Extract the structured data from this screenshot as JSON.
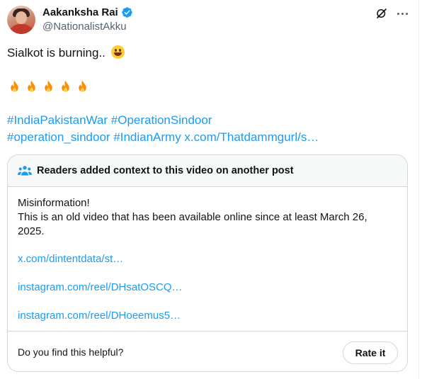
{
  "author": {
    "display_name": "Aakanksha Rai",
    "handle": "@NationalistAkku",
    "verified": true,
    "avatar_icon": "profile-photo"
  },
  "header_actions": {
    "grok_icon": "grok-icon",
    "more_icon": "more-options-icon"
  },
  "tweet": {
    "text": "Sialkot is burning..",
    "text_emoji": "grinning-sweat-emoji",
    "fire_emojis": [
      "fire",
      "fire",
      "fire",
      "fire",
      "fire"
    ],
    "hashtag_line_1": "#IndiaPakistanWar #OperationSindoor",
    "hashtag_line_2": "#operation_sindoor #IndianArmy x.com/Thatdammgurl/s…"
  },
  "community_note": {
    "title": "Readers added context to this video on another post",
    "title_icon": "people-icon",
    "body_line_1": "Misinformation!",
    "body_line_2": "This is an old video that has been available online since at least March 26,",
    "body_line_3": "2025.",
    "links": [
      "x.com/dintentdata/st…",
      "instagram.com/reel/DHsatOSCQ…",
      "instagram.com/reel/DHoeemus5…"
    ],
    "helpful_question": "Do you find this helpful?",
    "rate_button_label": "Rate it"
  },
  "colors": {
    "link_blue": "#1d9bf0",
    "secondary_text": "#536471",
    "border": "#cfd9de"
  }
}
